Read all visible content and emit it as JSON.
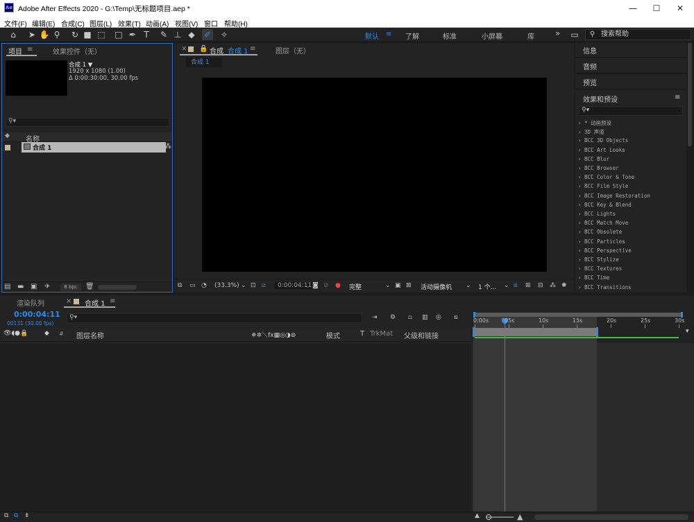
{
  "window": {
    "title": "Adobe After Effects 2020 - G:\\Temp\\无标题项目.aep *",
    "app_badge": "Ae",
    "minimize": "—",
    "maximize": "☐",
    "close": "✕"
  },
  "menu": [
    "文件(F)",
    "编辑(E)",
    "合成(C)",
    "图层(L)",
    "效果(T)",
    "动画(A)",
    "视图(V)",
    "窗口",
    "帮助(H)"
  ],
  "workspaces": {
    "items": [
      "默认",
      "了解",
      "标准",
      "小屏幕",
      "库"
    ],
    "active": "默认",
    "more": "»",
    "search_help": "搜索帮助"
  },
  "project_panel": {
    "tab_project": "项目",
    "tab_effects": "效果控件（无）",
    "comp_name": "合成 1 ▼",
    "comp_size": "1920 x 1080 (1.00)",
    "comp_duration": "Δ 0:00:30:00, 30.00 fps",
    "search_placeholder": "",
    "col_name": "名称",
    "item_name": "合成 1",
    "bpc": "8 bpc"
  },
  "comp_panel": {
    "tab_comp": "合成",
    "tab_comp_name": "合成 1",
    "tab_layer": "图层（无）",
    "breadcrumb": "合成 1",
    "zoom": "(33.3%)",
    "timecode": "0:00:04:11",
    "resolution": "完整",
    "camera": "活动摄像机",
    "views": "1 个..."
  },
  "right_panels": {
    "info": "信息",
    "audio": "音频",
    "preview": "预览",
    "effects_presets": "效果和预设",
    "effects": [
      "* 动画预设",
      "3D 声道",
      "BCC 3D Objects",
      "BCC Art Looks",
      "BCC Blur",
      "BCC Browser",
      "BCC Color & Tone",
      "BCC Film Style",
      "BCC Image Restoration",
      "BCC Key & Blend",
      "BCC Lights",
      "BCC Match Move",
      "BCC Obsolete",
      "BCC Particles",
      "BCC Perspective",
      "BCC Stylize",
      "BCC Textures",
      "BCC Time",
      "BCC Transitions"
    ]
  },
  "timeline": {
    "tab_render": "渲染队列",
    "tab_comp": "合成 1",
    "timecode": "0:00:04:11",
    "frames": "00131 (30.00 fps)",
    "col_layer_name": "图层名称",
    "col_mode": "模式",
    "col_t": "T",
    "col_trkmat": "TrkMat",
    "col_parent": "父级和链接",
    "ruler": [
      "0:00s",
      "05s",
      "10s",
      "15s",
      "20s",
      "25s",
      "30s"
    ],
    "playhead_seconds": 4.37,
    "work_area_end_seconds": 18
  },
  "colors": {
    "accent": "#2d8ceb",
    "panel": "#232323",
    "background": "#1d1d1d"
  }
}
